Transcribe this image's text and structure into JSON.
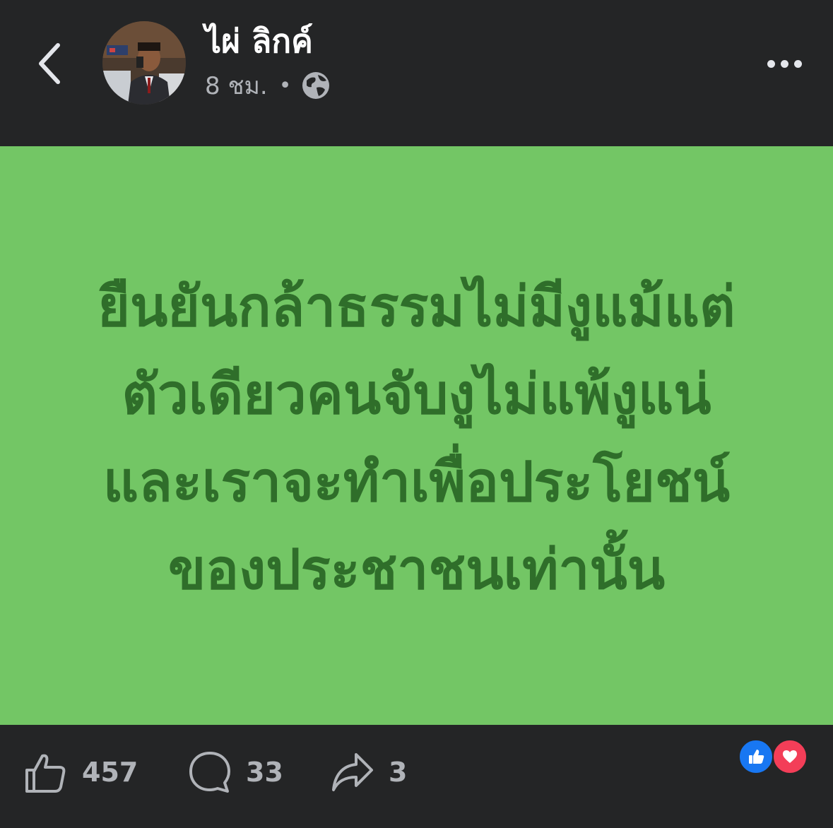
{
  "header": {
    "author_name": "ไผ่ ลิกค์",
    "time": "8 ชม.",
    "separator": "•",
    "privacy_icon": "globe-icon",
    "back_icon": "chevron-left-icon",
    "more_icon": "more-horizontal-icon"
  },
  "post": {
    "background_color": "#73c665",
    "text_color": "#2f6e2a",
    "lines": [
      "ยืนยันกล้าธรรมไม่มีงูแม้แต่",
      "ตัวเดียวคนจับงูไม่แพ้งูแน่",
      "และเราจะทำเพื่อประโยชน์",
      "ของประชาชนเท่านั้น"
    ]
  },
  "actions": {
    "like_count": "457",
    "comment_count": "33",
    "share_count": "3",
    "like_icon": "thumbs-up-icon",
    "comment_icon": "comment-bubble-icon",
    "share_icon": "share-arrow-icon"
  },
  "reactions": {
    "items": [
      "like-reaction-icon",
      "love-reaction-icon"
    ],
    "like_color": "#1877f2",
    "love_color": "#f33e58"
  }
}
